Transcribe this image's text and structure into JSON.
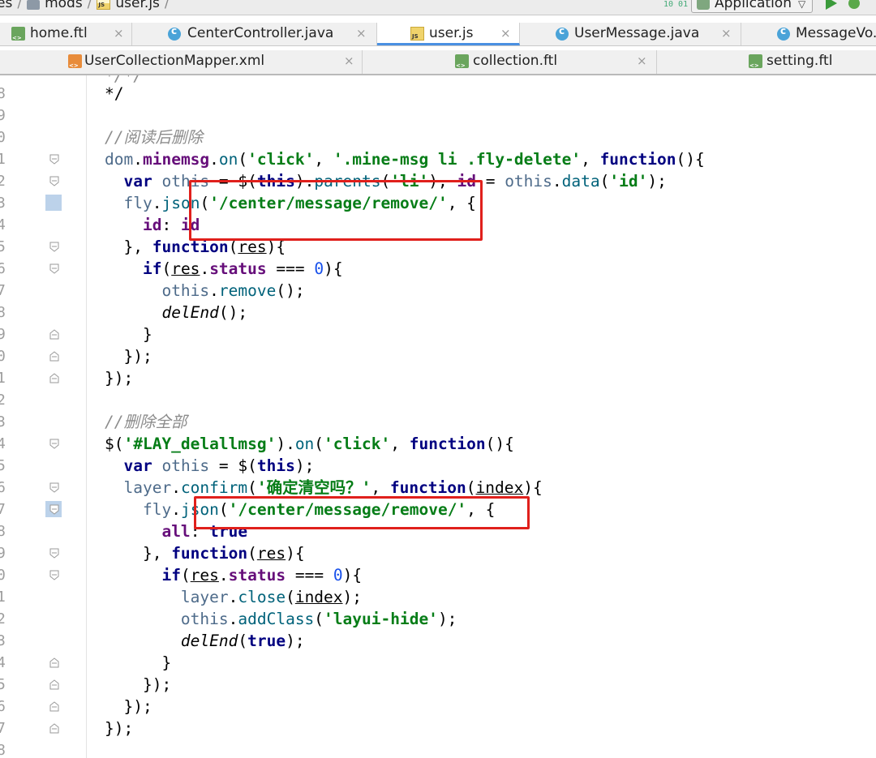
{
  "breadcrumb": {
    "items": [
      "es",
      "mods",
      "user.js"
    ],
    "separator": "/"
  },
  "toolbar": {
    "run_config": "Application",
    "vcs_label": "10 01"
  },
  "tabs_row1": [
    {
      "label": "home.ftl",
      "icon": "ftl-file-icon",
      "active": false
    },
    {
      "label": "CenterController.java",
      "icon": "class-icon",
      "active": false
    },
    {
      "label": "user.js",
      "icon": "js-file-icon",
      "active": true
    },
    {
      "label": "UserMessage.java",
      "icon": "class-icon",
      "active": false
    },
    {
      "label": "MessageVo.",
      "icon": "class-icon",
      "active": false
    }
  ],
  "tabs_row2": [
    {
      "label": "UserCollectionMapper.xml",
      "icon": "xml-file-icon"
    },
    {
      "label": "collection.ftl",
      "icon": "ftl-file-icon"
    },
    {
      "label": "setting.ftl",
      "icon": "ftl-file-icon"
    }
  ],
  "close_glyph": "×",
  "editor": {
    "line_numbers": [
      "8",
      "9",
      "0",
      "1",
      "2",
      "3",
      "4",
      "5",
      "6",
      "7",
      "8",
      "9",
      "0",
      "1",
      "2",
      "3",
      "4",
      "5",
      "6",
      "7",
      "8",
      "9",
      "0",
      "1",
      "2",
      "3",
      "4",
      "5",
      "6",
      "7",
      "8"
    ],
    "lines": [
      "*/",
      "",
      "//阅读后删除",
      "dom.minemsg.on('click', '.mine-msg li .fly-delete', function(){",
      "  var othis = $(this).parents('li'), id = othis.data('id');",
      "  fly.json('/center/message/remove/', {",
      "    id: id",
      "  }, function(res){",
      "    if(res.status === 0){",
      "      othis.remove();",
      "      delEnd();",
      "    }",
      "  });",
      "});",
      "",
      "//删除全部",
      "$('#LAY_delallmsg').on('click', function(){",
      "  var othis = $(this);",
      "  layer.confirm('确定清空吗？', function(index){",
      "    fly.json('/center/message/remove/', {",
      "      all: true",
      "    }, function(res){",
      "      if(res.status === 0){",
      "        layer.close(index);",
      "        othis.addClass('layui-hide');",
      "        delEnd(true);",
      "      }",
      "    });",
      "  });",
      "});",
      ""
    ]
  },
  "colors": {
    "keyword": "#000080",
    "string": "#067d17",
    "comment": "#8c8c8c",
    "number": "#1750eb",
    "highlight_box": "#e0201c",
    "active_tab_underline": "#4a90e2"
  }
}
